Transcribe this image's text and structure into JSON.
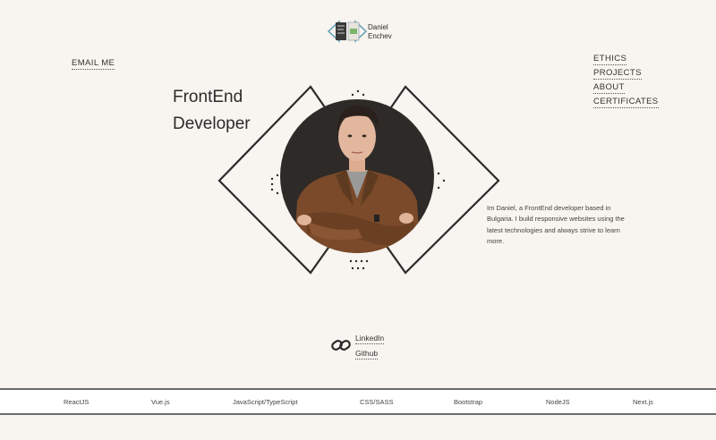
{
  "logo": {
    "line1": "Daniel",
    "line2": "Enchev",
    "icon": "code-brackets-logo-icon"
  },
  "nav": {
    "email": "EMAIL ME",
    "right": [
      "ETHICS",
      "PROJECTS",
      "ABOUT",
      "CERTIFICATES"
    ]
  },
  "hero": {
    "title_line1": "FrontEnd",
    "title_line2": "Developer",
    "bio": "Im Daniel, a FrontEnd developer based in Bulgaria. I build responsive websites using the latest technologies and always strive to learn more.",
    "photo_icon": "profile-photo"
  },
  "social": {
    "icon": "chain-link-icon",
    "links": [
      "LinkedIn",
      "Github"
    ]
  },
  "tech": [
    "ReactJS",
    "Vue.js",
    "JavaScript/TypeScript",
    "CSS/SASS",
    "Bootstrap",
    "NodeJS",
    "Next.js"
  ],
  "colors": {
    "background": "#f8f4ef",
    "dark": "#2b2b2b",
    "circle": "#2e2a28",
    "bar": "#ffffff"
  }
}
